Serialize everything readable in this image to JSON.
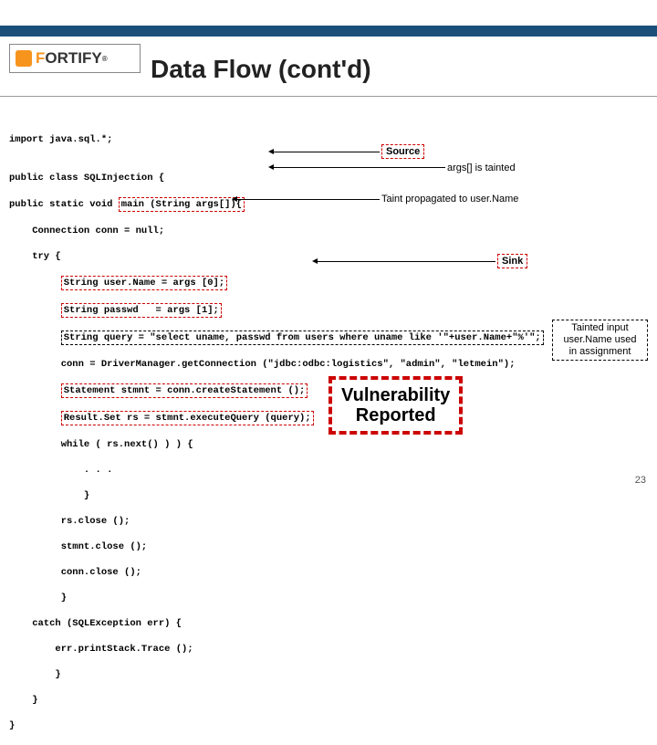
{
  "logo": {
    "text": "ORTIFY"
  },
  "title": "Data Flow (cont'd)",
  "code": {
    "l1": "import java.sql.*;",
    "l2": "",
    "l3_a": "public class SQLInjection {",
    "l4_a": "public static void ",
    "l4_b": "main (String args[]){",
    "l5": "    Connection conn = null;",
    "l6": "    try {",
    "l7_a": "         ",
    "l7_b": "String user.Name = args [0];",
    "l8_a": "         ",
    "l8_b": "String passwd   = args [1];",
    "l9_a": "         ",
    "l9_b": "String query = \"select uname, passwd from users where uname like '\"+user.Name+\"%'\";",
    "l10": "         conn = DriverManager.getConnection (\"jdbc:odbc:logistics\", \"admin\", \"letmein\");",
    "l11_a": "         ",
    "l11_b": "Statement stmnt = conn.createStatement ();",
    "l12_a": "         ",
    "l12_b": "Result.Set rs = stmnt.executeQuery (query);",
    "l13": "         while ( rs.next() ) ) {",
    "l14": "             . . .",
    "l15": "             }",
    "l16": "         rs.close ();",
    "l17": "         stmnt.close ();",
    "l18": "         conn.close ();",
    "l19": "         }",
    "l20": "    catch (SQLException err) {",
    "l21": "        err.printStack.Trace ();",
    "l22": "        }",
    "l23": "    }",
    "l24": "}"
  },
  "callouts": {
    "source": "Source",
    "args_tainted": "args[] is tainted",
    "taint_propagated": "Taint propagated to user.Name",
    "sink": "Sink",
    "tainted_input_l1": "Tainted input",
    "tainted_input_l2": "user.Name used",
    "tainted_input_l3": "in assignment",
    "vuln_l1": "Vulnerability",
    "vuln_l2": "Reported"
  },
  "page_number": "23"
}
